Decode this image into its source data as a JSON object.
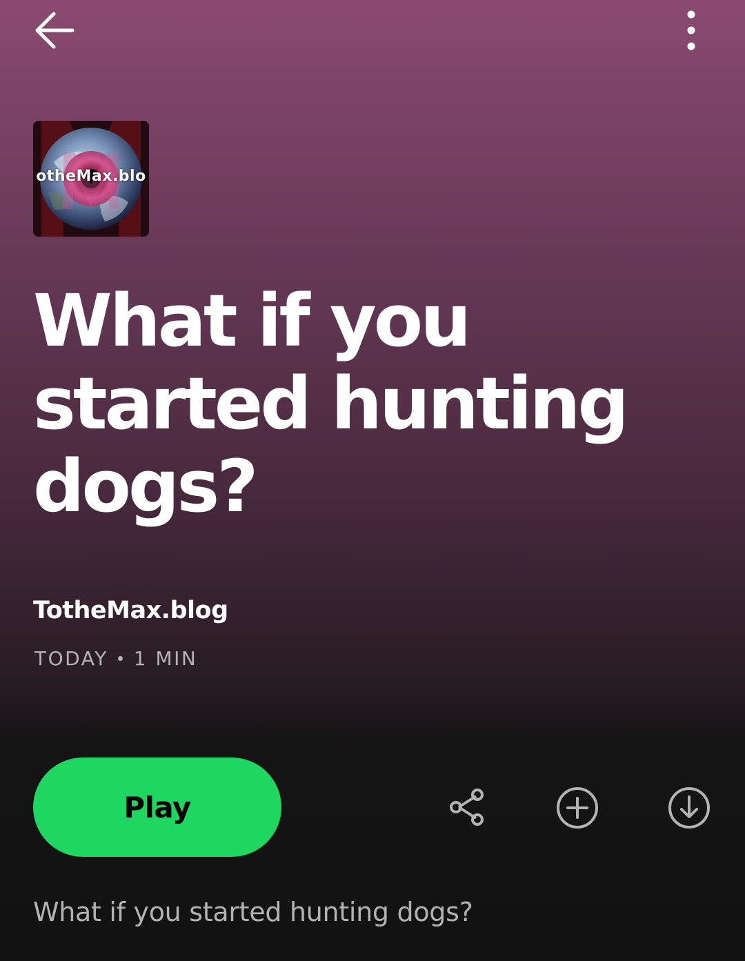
{
  "header": {
    "back_icon": "arrow-left-icon",
    "more_icon": "more-vertical-icon"
  },
  "cover": {
    "logo_text": "otheMax.blo"
  },
  "episode": {
    "title": "What if you started hunting dogs?",
    "publisher": "TotheMax.blog",
    "date": "TODAY",
    "duration": "1 MIN",
    "description": "What if you started hunting dogs?"
  },
  "actions": {
    "play_label": "Play",
    "share_icon": "share-icon",
    "add_icon": "add-circle-icon",
    "download_icon": "download-circle-icon"
  },
  "colors": {
    "accent": "#1ed760",
    "gradient_top": "#8b4a70",
    "background": "#121212",
    "secondary_text": "#b3b3b3"
  }
}
